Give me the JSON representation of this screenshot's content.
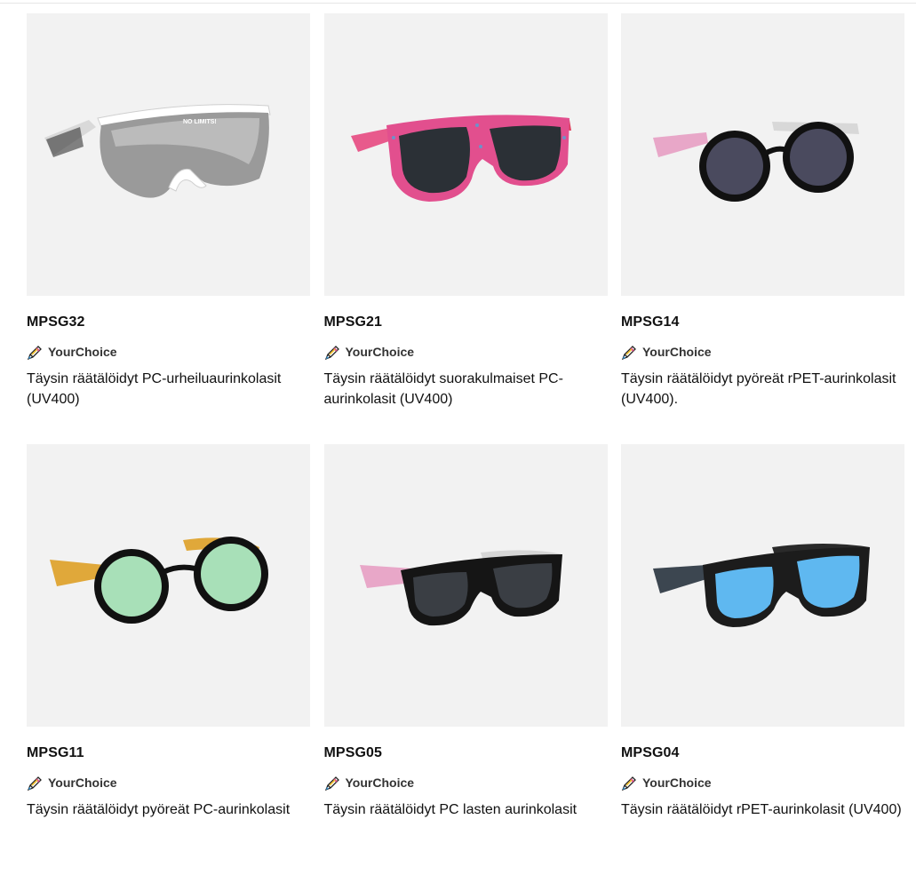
{
  "colors": {
    "card_bg": "#f2f2f2",
    "brand_badge_text": "#333333"
  },
  "products": [
    {
      "sku": "MPSG32",
      "brand": "YourChoice",
      "brand_icon": "pencil-icon",
      "title": "Täysin räätälöidyt PC-urheiluaurinkolasit (UV400)",
      "image": "sport-shield-sunglasses",
      "print_text": "NO LIMITS!"
    },
    {
      "sku": "MPSG21",
      "brand": "YourChoice",
      "brand_icon": "pencil-icon",
      "title": "Täysin räätälöidyt suorakulmaiset PC-aurinkolasit (UV400)",
      "image": "rectangular-pink-pattern-sunglasses"
    },
    {
      "sku": "MPSG14",
      "brand": "YourChoice",
      "brand_icon": "pencil-icon",
      "title": "Täysin räätälöidyt pyöreät rPET-aurinkolasit (UV400).",
      "image": "round-black-sunglasses"
    },
    {
      "sku": "MPSG11",
      "brand": "YourChoice",
      "brand_icon": "pencil-icon",
      "title": "Täysin räätälöidyt pyöreät PC-aurinkolasit",
      "image": "round-mirror-yellow-sunglasses"
    },
    {
      "sku": "MPSG05",
      "brand": "YourChoice",
      "brand_icon": "pencil-icon",
      "title": "Täysin räätälöidyt PC lasten aurinkolasit",
      "image": "kids-black-sunglasses"
    },
    {
      "sku": "MPSG04",
      "brand": "YourChoice",
      "brand_icon": "pencil-icon",
      "title": "Täysin räätälöidyt rPET-aurinkolasit (UV400)",
      "image": "blue-mirror-camo-sunglasses"
    }
  ]
}
